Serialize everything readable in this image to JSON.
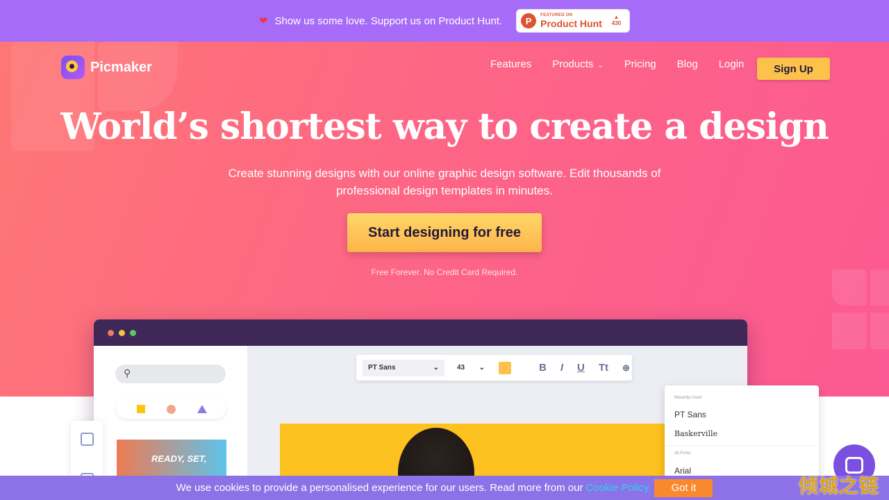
{
  "topbar": {
    "message": "Show us some love. Support us on Product Hunt.",
    "ph_small": "FEATURED ON",
    "ph_big": "Product Hunt",
    "ph_votes": "430",
    "ph_logo": "P"
  },
  "brand": {
    "name": "Picmaker"
  },
  "nav": {
    "features": "Features",
    "products": "Products",
    "pricing": "Pricing",
    "blog": "Blog",
    "login": "Login",
    "signup": "Sign Up"
  },
  "hero": {
    "title": "World’s shortest way to create a design",
    "subtitle_line1": "Create stunning designs with our online graphic design software. Edit thousands of",
    "subtitle_line2": "professional design templates in minutes.",
    "cta": "Start designing for free",
    "note": "Free Forever. No Credit Card Required."
  },
  "editor": {
    "font": "PT Sans",
    "size": "43",
    "thumb_text": "READY, SET,"
  },
  "font_panel": {
    "recent_label": "Recently Used",
    "recent": [
      "PT Sans",
      "Baskerville"
    ],
    "all_label": "All Fonts",
    "all": [
      "Arial"
    ]
  },
  "cookie": {
    "text": "We use cookies to provide a personalised experience for our users. Read more from our",
    "link": "Cookie Policy.",
    "button": "Got it"
  },
  "watermark": "倾城之链",
  "colors": {
    "topbar": "#a66cf7",
    "hero_start": "#fe7675",
    "hero_end": "#fc5992",
    "cta": "#fdb44a",
    "cookie_bar": "#8c72e6",
    "cookie_button": "#f9892c",
    "link": "#2ad3f4"
  }
}
